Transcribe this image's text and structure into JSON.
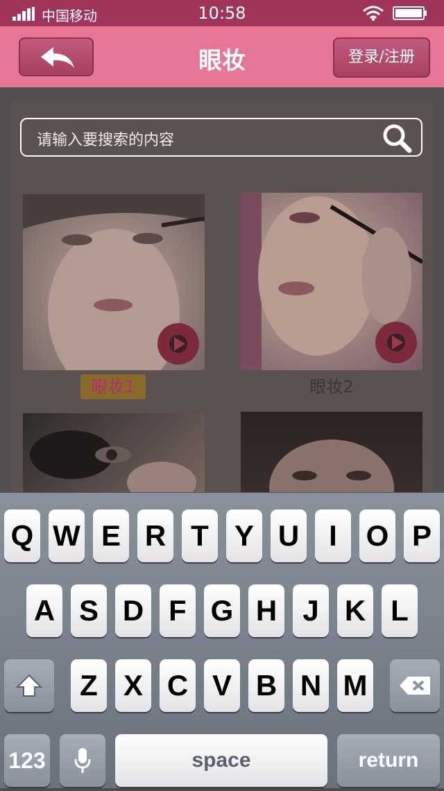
{
  "status_bar": {
    "carrier": "中国移动",
    "time": "10:58"
  },
  "nav": {
    "title": "眼妆",
    "login_label": "登录/注册"
  },
  "search": {
    "placeholder": "请输入要搜索的内容"
  },
  "grid": {
    "captions": [
      "眼妆1",
      "眼妆2"
    ]
  },
  "keyboard": {
    "row1": [
      "Q",
      "W",
      "E",
      "R",
      "T",
      "Y",
      "U",
      "I",
      "O",
      "P"
    ],
    "row2": [
      "A",
      "S",
      "D",
      "F",
      "G",
      "H",
      "J",
      "K",
      "L"
    ],
    "row3": [
      "Z",
      "X",
      "C",
      "V",
      "B",
      "N",
      "M"
    ],
    "numbers_label": "123",
    "space_label": "space",
    "return_label": "return"
  },
  "colors": {
    "nav_bg": "#e77595",
    "status_bg": "#a0345a",
    "accent_caption": "#b0306a"
  }
}
